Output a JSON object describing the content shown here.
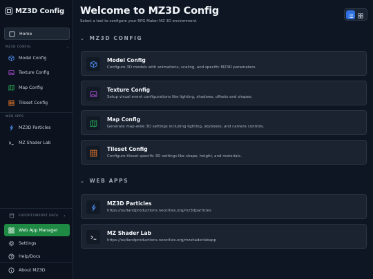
{
  "app": {
    "title": "MZ3D Config"
  },
  "sidebar": {
    "home_label": "Home",
    "mz3d_section": "MZ3D CONFIG",
    "mz3d_items": [
      {
        "label": "Model Config",
        "icon": "cube-icon"
      },
      {
        "label": "Texture Config",
        "icon": "image-icon"
      },
      {
        "label": "Map Config",
        "icon": "map-icon"
      },
      {
        "label": "Tileset Config",
        "icon": "grid-icon"
      }
    ],
    "web_section": "WEB APPS",
    "web_items": [
      {
        "label": "MZ3D Particles",
        "icon": "sparkle-icon"
      },
      {
        "label": "MZ Shader Lab",
        "icon": "terminal-icon"
      }
    ],
    "export_section": "EXPORT/IMPORT DATA",
    "bottom_items": [
      {
        "label": "Web App Manager",
        "icon": "grid-icon"
      },
      {
        "label": "Settings",
        "icon": "gear-icon"
      },
      {
        "label": "Help/Docs",
        "icon": "help-icon"
      },
      {
        "label": "About MZ3D",
        "icon": "info-icon"
      }
    ]
  },
  "main": {
    "title": "Welcome to MZ3D Config",
    "subtitle": "Select a tool to configure your RPG Maker MZ 3D environment.",
    "sections": [
      {
        "heading": "MZ3D CONFIG",
        "cards": [
          {
            "title": "Model Config",
            "desc": "Configure 3D models with animations, scaling, and specific MZ3D parameters.",
            "icon": "cube-icon"
          },
          {
            "title": "Texture Config",
            "desc": "Setup visual event configurations like lighting, shadows, offsets and shapes.",
            "icon": "image-icon"
          },
          {
            "title": "Map Config",
            "desc": "Generate map-wide 3D settings including lighting, skyboxes, and camera controls.",
            "icon": "map-icon"
          },
          {
            "title": "Tileset Config",
            "desc": "Configure tileset specific 3D settings like shape, height, and materials.",
            "icon": "grid-icon"
          }
        ]
      },
      {
        "heading": "WEB APPS",
        "cards": [
          {
            "title": "MZ3D Particles",
            "desc": "https://outlandproductions.neocities.org/mz3dparticles",
            "icon": "sparkle-icon"
          },
          {
            "title": "MZ Shader Lab",
            "desc": "https://outlandproductions.neocities.org/mzshaderlabapp",
            "icon": "terminal-icon"
          }
        ]
      }
    ]
  },
  "colors": {
    "accent_blue": "#2f6fe0",
    "accent_green": "#1e8a44",
    "model_icon": "#4d8df0",
    "texture_icon": "#b44fe0",
    "map_icon": "#25b55a",
    "tileset_icon": "#f07a2a"
  }
}
